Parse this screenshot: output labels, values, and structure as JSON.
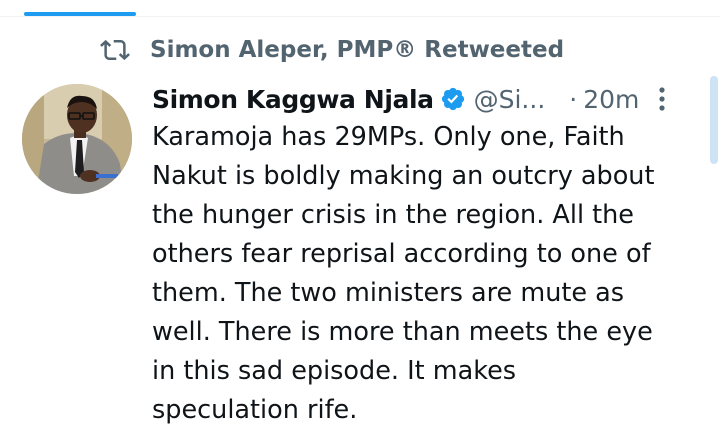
{
  "retweet_context": {
    "icon": "retweet-icon",
    "text": "Simon Aleper, PMP® Retweeted"
  },
  "tweet": {
    "author": {
      "name": "Simon Kaggwa Njala",
      "verified": true,
      "verified_icon": "verified-badge-icon",
      "handle": "@Si..."
    },
    "separator": "·",
    "timestamp": "20m",
    "more_icon": "more-vertical-icon",
    "text": "Karamoja has 29MPs. Only one, Faith\nNakut is boldly making an outcry about\nthe hunger crisis in the region. All the\nothers fear reprisal according to one of\nthem. The two ministers are mute as\nwell. There is more than meets the eye\nin this sad episode. It makes\nspeculation rife."
  },
  "colors": {
    "accent": "#1d9bf0",
    "text_primary": "#0f1419",
    "text_secondary": "#536471",
    "background": "#ffffff"
  }
}
